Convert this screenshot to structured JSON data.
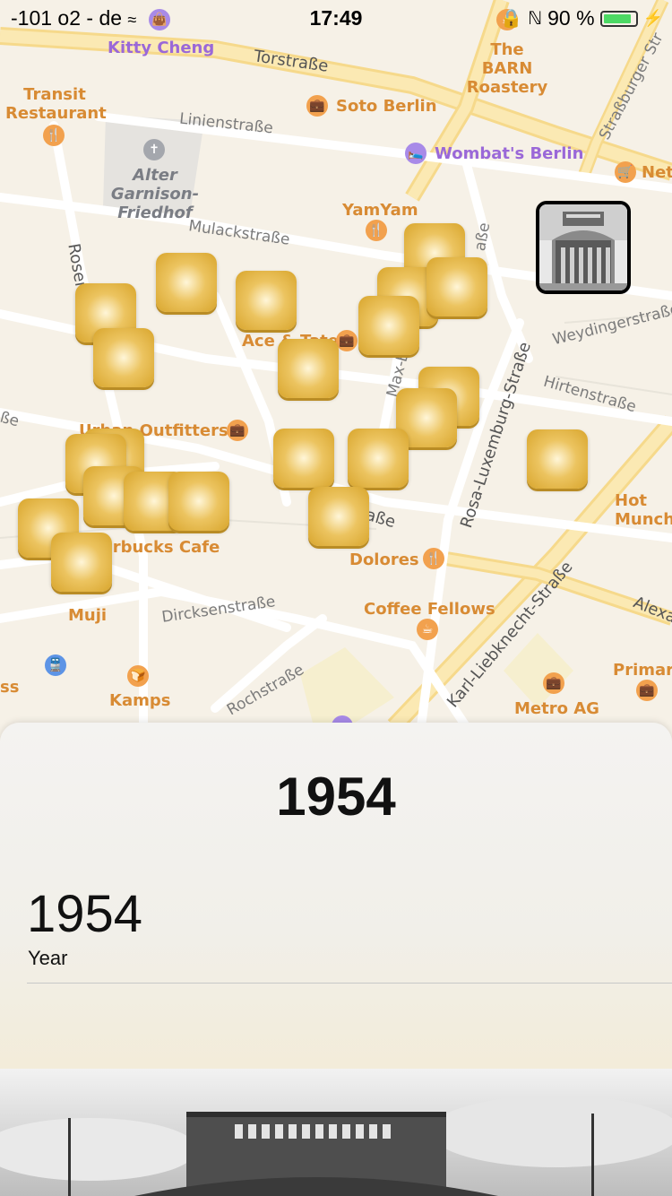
{
  "status_bar": {
    "carrier": "-101 o2 - de",
    "time": "17:49",
    "battery": "90 %",
    "battery_level": 0.9
  },
  "map": {
    "streets": [
      "Torstraße",
      "Linienstraße",
      "Mulackstraße",
      "Rosen",
      "Weydingerstraße",
      "Hirtenstraße",
      "Rosa-Luxemburg-Straße",
      "Karl-Liebknecht-Straße",
      "Dircksenstraße",
      "Rochstraße",
      "Straßburger Str",
      "Max-Be",
      "Alexa",
      "aße",
      "aße",
      "ße"
    ],
    "pois": [
      {
        "name": "Kitty Cheng",
        "icon": "shopping-bag-icon"
      },
      {
        "name": "The BARN Roastery",
        "icon": "coffee-icon"
      },
      {
        "name": "Transit Restaurant",
        "icon": "fork-knife-icon"
      },
      {
        "name": "Soto Berlin",
        "icon": "shopping-bag-icon"
      },
      {
        "name": "Alter Garnison-Friedhof",
        "icon": "cemetery-icon"
      },
      {
        "name": "Wombat's Berlin",
        "icon": "bed-icon"
      },
      {
        "name": "Net",
        "icon": "cart-icon"
      },
      {
        "name": "YamYam",
        "icon": "fork-knife-icon"
      },
      {
        "name": "Ace & Tate",
        "icon": "shopping-bag-icon"
      },
      {
        "name": "Urban Outfitters",
        "icon": "shopping-bag-icon"
      },
      {
        "name": "Starbucks Cafe",
        "icon": "coffee-icon"
      },
      {
        "name": "Dolores",
        "icon": "fork-knife-icon"
      },
      {
        "name": "Coffee Fellows",
        "icon": "coffee-icon"
      },
      {
        "name": "Muji",
        "icon": "shopping-bag-icon"
      },
      {
        "name": "Kamps",
        "icon": "croissant-icon"
      },
      {
        "name": "Metro AG",
        "icon": "briefcase-icon"
      },
      {
        "name": "Primar",
        "icon": "shopping-bag-icon"
      },
      {
        "name": "Hot Munch",
        "icon": "fork-knife-icon"
      },
      {
        "name": "ss",
        "icon": "train-icon"
      }
    ]
  },
  "sheet": {
    "title": "1954",
    "year_value": "1954",
    "year_label": "Year"
  }
}
